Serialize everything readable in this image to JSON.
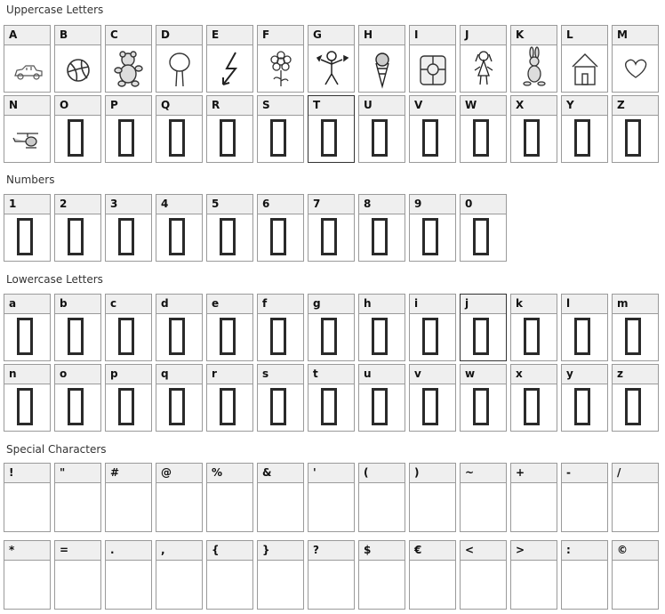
{
  "sections": {
    "uppercase_title": "Uppercase Letters",
    "numbers_title": "Numbers",
    "lowercase_title": "Lowercase Letters",
    "special_title": "Special Characters"
  },
  "uppercase": [
    {
      "ch": "A",
      "icon": "car-icon"
    },
    {
      "ch": "B",
      "icon": "ball-icon"
    },
    {
      "ch": "C",
      "icon": "teddy-bear-icon"
    },
    {
      "ch": "D",
      "icon": "tree-icon"
    },
    {
      "ch": "E",
      "icon": "lightning-arrow-icon"
    },
    {
      "ch": "F",
      "icon": "flower-icon"
    },
    {
      "ch": "G",
      "icon": "stick-figure-stars-icon"
    },
    {
      "ch": "H",
      "icon": "ice-cream-icon"
    },
    {
      "ch": "I",
      "icon": "gift-box-icon"
    },
    {
      "ch": "J",
      "icon": "girl-figure-icon"
    },
    {
      "ch": "K",
      "icon": "bunny-icon"
    },
    {
      "ch": "L",
      "icon": "house-icon"
    },
    {
      "ch": "M",
      "icon": "heart-icon"
    },
    {
      "ch": "N",
      "icon": "helicopter-icon"
    },
    {
      "ch": "O"
    },
    {
      "ch": "P"
    },
    {
      "ch": "Q"
    },
    {
      "ch": "R"
    },
    {
      "ch": "S"
    },
    {
      "ch": "T"
    },
    {
      "ch": "U"
    },
    {
      "ch": "V"
    },
    {
      "ch": "W"
    },
    {
      "ch": "X"
    },
    {
      "ch": "Y"
    },
    {
      "ch": "Z"
    }
  ],
  "numbers": [
    "1",
    "2",
    "3",
    "4",
    "5",
    "6",
    "7",
    "8",
    "9",
    "0"
  ],
  "lowercase": [
    "a",
    "b",
    "c",
    "d",
    "e",
    "f",
    "g",
    "h",
    "i",
    "j",
    "k",
    "l",
    "m",
    "n",
    "o",
    "p",
    "q",
    "r",
    "s",
    "t",
    "u",
    "v",
    "w",
    "x",
    "y",
    "z"
  ],
  "special": [
    "!",
    "\"",
    "#",
    "@",
    "%",
    "&",
    "'",
    "(",
    ")",
    "~",
    "+",
    "-",
    "/",
    "*",
    "=",
    ".",
    ",",
    "{",
    "}",
    "?",
    "$",
    "€",
    "<",
    ">",
    ":",
    "©"
  ]
}
